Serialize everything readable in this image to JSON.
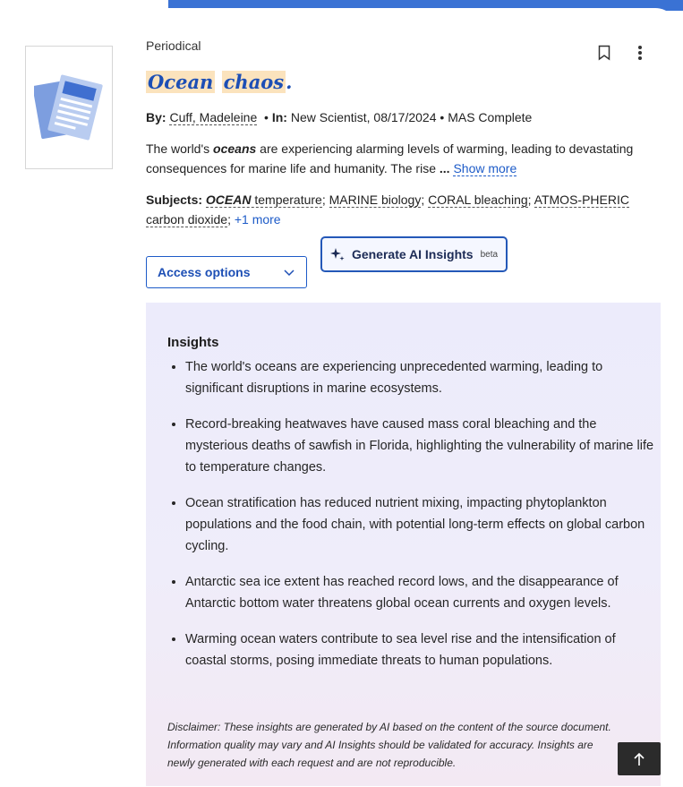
{
  "record": {
    "type": "Periodical",
    "title_word1": "Ocean",
    "title_word2": "chaos",
    "title_end": ".",
    "by_label": "By:",
    "author": "Cuff, Madeleine",
    "in_label": "In:",
    "source": "New Scientist, 08/17/2024",
    "separator": "•",
    "database": "MAS Complete",
    "abstract_prefix": "The world's ",
    "abstract_highlight": "oceans",
    "abstract_rest": " are experiencing alarming levels of warming, leading to devastating consequences for marine life and humanity. The rise",
    "ellipsis": "...",
    "show_more": "Show more",
    "subjects_label": "Subjects:",
    "subjects": [
      {
        "hl": "OCEAN",
        "text": "temperature",
        "sep": "; "
      },
      {
        "text": "MARINE biology",
        "sep": "; "
      },
      {
        "text": "CORAL bleaching",
        "sep": "; "
      },
      {
        "text": "ATMOS-PHERIC carbon dioxide",
        "sep": "; "
      }
    ],
    "more_subjects": "+1 more"
  },
  "actions": {
    "access_options": "Access options",
    "ai_insights": "Generate AI Insights",
    "ai_badge": "beta"
  },
  "insights": {
    "heading": "Insights",
    "items": [
      "The world's oceans are experiencing unprecedented warming, leading to significant disruptions in marine ecosystems.",
      "Record-breaking heatwaves have caused mass coral bleaching and the mysterious deaths of sawfish in Florida, highlighting the vulnerability of marine life to temperature changes.",
      "Ocean stratification has reduced nutrient mixing, impacting phytoplankton populations and the food chain, with potential long-term effects on global carbon cycling.",
      "Antarctic sea ice extent has reached record lows, and the disappearance of Antarctic bottom water threatens global ocean currents and oxygen levels.",
      "Warming ocean waters contribute to sea level rise and the intensification of coastal storms, posing immediate threats to human populations."
    ],
    "disclaimer": "Disclaimer: These insights are generated by AI based on the content of the source document. Information quality may vary and AI Insights should be validated for accuracy. Insights are newly generated with each request and are not reproducible."
  },
  "icons": {
    "bookmark": "bookmark-icon",
    "more": "more-vertical-icon",
    "dropdown": "chevron-down-icon",
    "sparkle": "sparkle-icon",
    "scroll_top": "arrow-up-icon",
    "publication": "periodical-icon"
  },
  "colors": {
    "accent": "#1d5bc8",
    "title": "#1d4fb5",
    "highlight": "#fbe3bd",
    "panel": "#ecebfb",
    "header_strip": "#3a72d4"
  }
}
